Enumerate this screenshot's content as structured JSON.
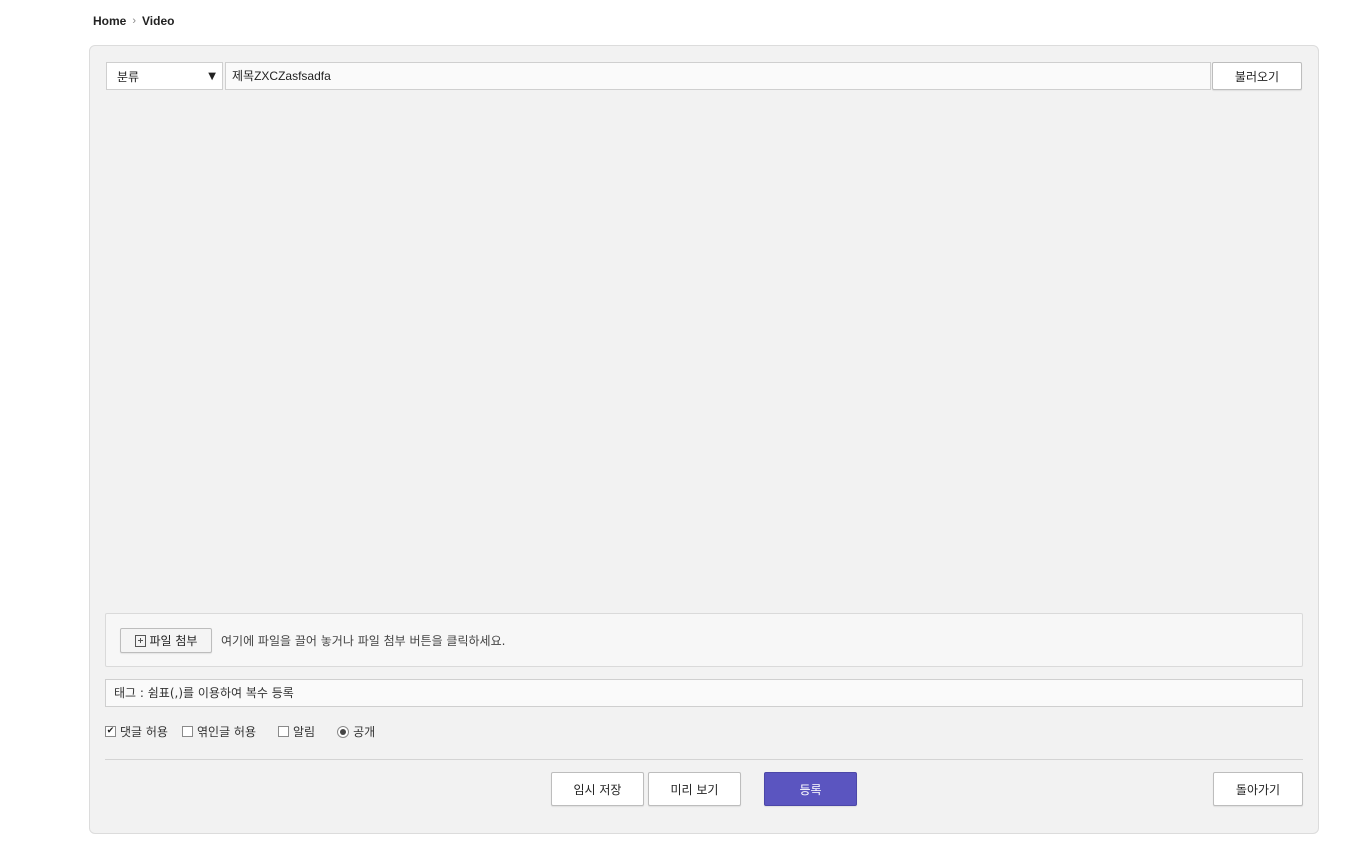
{
  "breadcrumb": {
    "home": "Home",
    "separator": "›",
    "current": "Video"
  },
  "form": {
    "category": {
      "selected": "분류",
      "caret": "▼"
    },
    "title_value": "제목ZXCZasfsadfa",
    "load_button": "불러오기"
  },
  "attach": {
    "button_label": "파일 첨부",
    "hint": "여기에 파일을 끌어 놓거나 파일 첨부 버튼을 클릭하세요."
  },
  "tags": {
    "placeholder": "태그 : 쉼표(,)를 이용하여 복수 등록"
  },
  "options": {
    "allow_comments": {
      "label": "댓글 허용",
      "checked": true
    },
    "allow_trackback": {
      "label": "엮인글 허용",
      "checked": false
    },
    "notify": {
      "label": "알림",
      "checked": false
    },
    "public": {
      "label": "공개",
      "selected": true
    }
  },
  "actions": {
    "temp_save": "임시 저장",
    "preview": "미리 보기",
    "submit": "등록",
    "back": "돌아가기"
  },
  "colors": {
    "submit_bg": "#5b55c0",
    "panel_bg": "#f2f2f2"
  }
}
